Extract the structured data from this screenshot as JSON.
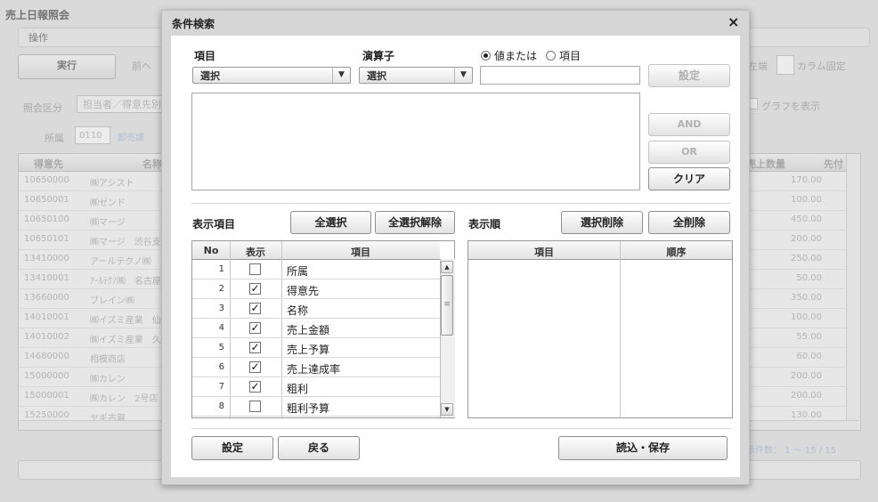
{
  "background": {
    "title": "売上日報照会",
    "menu": "操作",
    "execute_label": "実行",
    "prev_label": "前へ",
    "left_end_label": "左端",
    "column_fix_label": "カラム固定",
    "query_type_label": "照会区分",
    "query_type_value": "担当者／得意先別",
    "dept_label": "所属",
    "dept_code": "0110",
    "dept_name": "卸売課",
    "graph_label": "グラフを表示",
    "grid_headers": [
      "得意先",
      "名称",
      "売上数量",
      "先付"
    ],
    "rows": [
      {
        "code": "10650000",
        "name": "㈱アシスト",
        "qty": "170.00"
      },
      {
        "code": "10650001",
        "name": "㈱ゼンド",
        "qty": "100.00"
      },
      {
        "code": "10650100",
        "name": "㈱マージ",
        "qty": "450.00"
      },
      {
        "code": "10650101",
        "name": "㈱マージ　渋谷支",
        "qty": "200.00"
      },
      {
        "code": "13410000",
        "name": "アールテクノ㈱",
        "qty": "250.00"
      },
      {
        "code": "13410001",
        "name": "ｱｰﾙﾃｸﾉ㈱　名古屋",
        "qty": "50.00"
      },
      {
        "code": "13660000",
        "name": "ブレイン㈱",
        "qty": "350.00"
      },
      {
        "code": "14010001",
        "name": "㈱イズミ産業　仙",
        "qty": "100.00"
      },
      {
        "code": "14010002",
        "name": "㈱イズミ産業　久",
        "qty": "55.00"
      },
      {
        "code": "14680000",
        "name": "相模商店",
        "qty": "60.00"
      },
      {
        "code": "15000000",
        "name": "㈱カレン",
        "qty": "200.00"
      },
      {
        "code": "15000001",
        "name": "㈱カレン　2号店",
        "qty": "200.00"
      },
      {
        "code": "15250000",
        "name": "ヤギ古賀",
        "qty": "130.00"
      }
    ],
    "display_count": "表示件数：  1 〜 15 / 15"
  },
  "modal": {
    "title": "条件検索",
    "close_glyph": "×",
    "field_label": "項目",
    "field_select": "選択",
    "operator_label": "演算子",
    "operator_select": "選択",
    "radio_value": "値または",
    "radio_item": "項目",
    "set_label": "設定",
    "and_label": "AND",
    "or_label": "OR",
    "clear_label": "クリア",
    "display_items_label": "表示項目",
    "select_all_label": "全選択",
    "deselect_all_label": "全選択解除",
    "display_order_label": "表示順",
    "remove_selected_label": "選択削除",
    "remove_all_label": "全削除",
    "items_headers": {
      "no": "No",
      "show": "表示",
      "item": "項目"
    },
    "items": [
      {
        "no": "1",
        "checked": false,
        "label": "所属"
      },
      {
        "no": "2",
        "checked": true,
        "label": "得意先"
      },
      {
        "no": "3",
        "checked": true,
        "label": "名称"
      },
      {
        "no": "4",
        "checked": true,
        "label": "売上金額"
      },
      {
        "no": "5",
        "checked": true,
        "label": "売上予算"
      },
      {
        "no": "6",
        "checked": true,
        "label": "売上達成率"
      },
      {
        "no": "7",
        "checked": true,
        "label": "粗利"
      },
      {
        "no": "8",
        "checked": false,
        "label": "粗利予算"
      }
    ],
    "order_headers": {
      "item": "項目",
      "order": "順序"
    },
    "footer_set_label": "設定",
    "back_label": "戻る",
    "load_save_label": "読込・保存"
  }
}
